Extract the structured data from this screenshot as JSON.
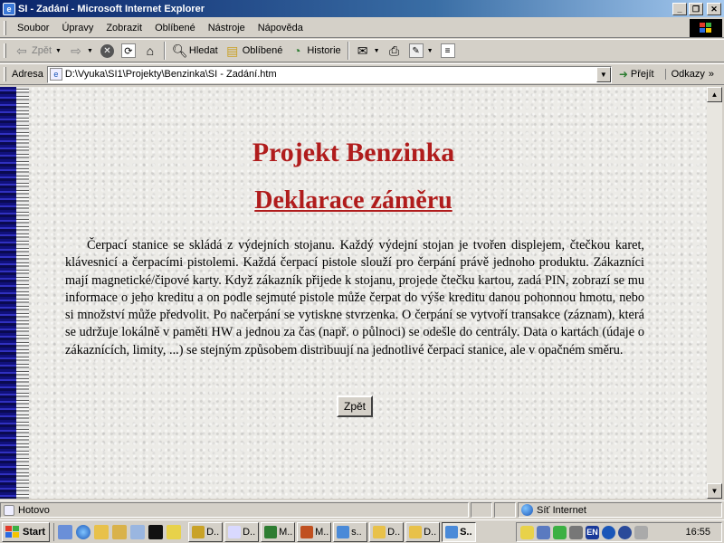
{
  "window": {
    "title": "SI - Zadání - Microsoft Internet Explorer",
    "minimize": "_",
    "maximize": "❐",
    "close": "✕"
  },
  "menu": [
    "Soubor",
    "Úpravy",
    "Zobrazit",
    "Oblíbené",
    "Nástroje",
    "Nápověda"
  ],
  "toolbar": {
    "back": "Zpět",
    "search": "Hledat",
    "favorites": "Oblíbené",
    "history": "Historie"
  },
  "address": {
    "label": "Adresa",
    "url": "D:\\Vyuka\\SI1\\Projekty\\Benzinka\\SI - Zadání.htm",
    "go": "Přejít",
    "links": "Odkazy"
  },
  "page": {
    "title": "Projekt Benzinka",
    "subtitle": "Deklarace záměru",
    "paragraph": "Čerpací stanice se skládá z výdejních stojanu. Každý výdejní stojan je tvořen displejem, čtečkou karet, klávesnicí a čerpacími pistolemi. Každá čerpací pistole slouží pro čerpání právě jednoho produktu. Zákazníci mají magnetické/čipové karty. Když zákazník přijede k stojanu, projede čtečku kartou, zadá PIN, zobrazí se mu informace o jeho kreditu a on podle sejmuté pistole může čerpat do výše kreditu danou pohonnou hmotu, nebo si množství může předvolit. Po načerpání se vytiskne stvrzenka. O čerpání se vytvoří transakce (záznam), která se udržuje lokálně v paměti HW a jednou za čas (např. o půlnoci) se odešle do centrály. Data o kartách (údaje o zákaznících, limity, ...) se stejným způsobem distribuují na jednotlivé čerpací stanice, ale v opačném směru.",
    "back_button": "Zpět"
  },
  "status": {
    "text": "Hotovo",
    "zone": "Síť Internet"
  },
  "taskbar": {
    "start": "Start",
    "tasks": [
      "D..",
      "D..",
      "M..",
      "M..",
      "s..",
      "D..",
      "D..",
      "S.."
    ],
    "clock": "16:55",
    "lang": "EN"
  },
  "colors": {
    "heading": "#b01c1c",
    "titlebar_start": "#0a246a",
    "titlebar_end": "#a6caf0"
  }
}
